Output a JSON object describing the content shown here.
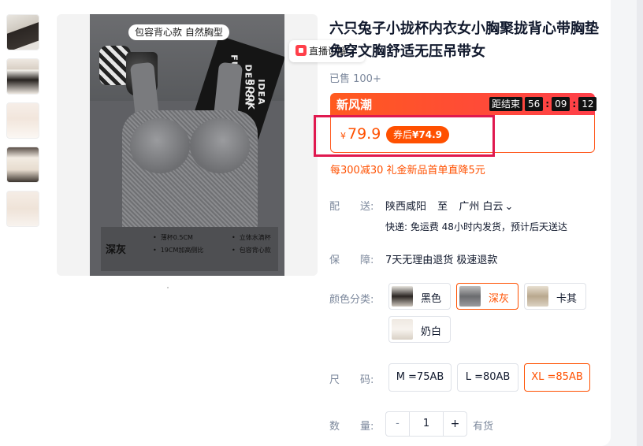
{
  "gallery": {
    "thumbnails": [
      "thumb-1",
      "thumb-2",
      "thumb-3",
      "thumb-4",
      "thumb-5"
    ],
    "caption": "包容背心款 自然胸型",
    "live_badge": "直播讲解",
    "live_badge_chevron": "›",
    "book_text_1": "FURNITU",
    "book_text_2": "DESIGN",
    "book_text_3": "IDEA BOOK",
    "spec_color": "深灰",
    "spec_left": [
      "薄杯0.5CM",
      "19CM加高侧比"
    ],
    "spec_right": [
      "立体水滴杯",
      "包容背心款"
    ]
  },
  "product": {
    "title": "六只兔子小拢杯内衣女小胸聚拢背心带胸垫免穿文胸舒适无压吊带女",
    "sold": "已售 100+"
  },
  "promo": {
    "name": "新风潮",
    "countdown_label": "距结束",
    "hours": "56",
    "minutes": "09",
    "seconds": "12",
    "sep": ":",
    "currency": "¥",
    "price": "79.9",
    "after_label": "券后",
    "after_price": "¥74.9",
    "coupon": "每300减30 礼金新品首单直降5元"
  },
  "shipping": {
    "label": "配　　送:",
    "from": "陕西咸阳",
    "to_word": "至",
    "to": "广州 白云",
    "chevron": "⌄",
    "detail": "快递: 免运费  48小时内发货，预计后天送达"
  },
  "guarantee": {
    "label": "保　　障:",
    "text": "7天无理由退货 极速退款"
  },
  "colors": {
    "label": "颜色分类:",
    "options": [
      {
        "label": "黑色",
        "selected": false
      },
      {
        "label": "深灰",
        "selected": true
      },
      {
        "label": "卡其",
        "selected": false
      },
      {
        "label": "奶白",
        "selected": false
      }
    ]
  },
  "sizes": {
    "label": "尺　　码:",
    "options": [
      {
        "label": "M =75AB",
        "selected": false
      },
      {
        "label": "L =80AB",
        "selected": false
      },
      {
        "label": "XL =85AB",
        "selected": true
      }
    ]
  },
  "quantity": {
    "label": "数　　量:",
    "minus": "-",
    "value": "1",
    "plus": "+",
    "stock": "有货"
  },
  "theme": {
    "accent": "#ff5000",
    "promo_red": "#ff3f4a",
    "highlight_box": "#e0194f",
    "text_primary": "#11192d",
    "text_secondary": "#7c889c"
  }
}
